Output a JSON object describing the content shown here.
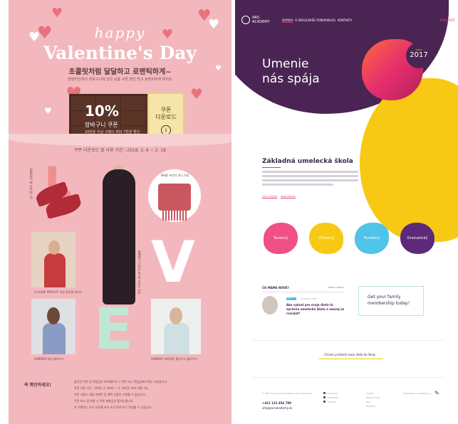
{
  "left": {
    "happy": "happy",
    "title": "Valentine's Day",
    "korean_headline": "초콜릿처럼 달달하고 로맨틱하게~",
    "korean_sub": "발렌타인데이 장바구니에 담은 상품 쿠폰 할인 받고 로맨틱하게 데이트",
    "coupon_pct": "10%",
    "coupon_label": "장바구니 쿠폰",
    "coupon_note": "20만원 이상 구매시 최대 7만원 할인",
    "coupon_download": "쿠폰\n다운로드",
    "coupon_download_icon": "down-arrow",
    "period": "쿠폰 다운로드 및 사용 기간 : 2018. 2. 6 ~ 2. 18",
    "letters": [
      "L",
      "V",
      "E"
    ],
    "captions": [
      "CLAUDE PIERLOT 프릴 플로럴 원피스",
      "SANDRO 벨 소매 울 니트",
      "BIMBA Y LOLA 파이버 브라스 가방",
      "MAJE 프린지 미니 가방",
      "SANDRO 테리 블라우스",
      "SANDRO 퍼플레트 블라우스 블라우스"
    ],
    "notice_title": "꼭 확인하세요!",
    "notice_lines": [
      "할인된 쿠폰 및 적립금은 마이페이지 > 쿠폰 또는 적립금에서 확인 가능합니다.",
      "쿠폰 사용 기간 : 2018. 2. 6(화) ~ 2. 18(일) 까지 사용 가능",
      "쿠폰 사용시 세일 이벤트 등 혜택 상품은 사용할 수 없습니다.",
      "주문 취소 및 반품 시 쿠폰 재발급이 불가능합니다.",
      "본 이벤트는 당사 사정에 따라 조기 종료 또는 변경될 수 있습니다."
    ]
  },
  "right": {
    "logo": "ARS ACADEMY",
    "nav": [
      "DOMOV",
      "O ŠKOLE",
      "NAŠE PONUKY",
      "BLOG",
      "KONTAKTY"
    ],
    "login": "PRIHLÁSIŤ",
    "hero_line1": "Umenie",
    "hero_line2": "nás spája",
    "since_label": "SINCE",
    "since_year": "2017",
    "section_title": "Základná umelecká škola",
    "links": [
      "VIAC O ŠKOLE",
      "NAŠE PONUKY"
    ],
    "departments": [
      "Tanečný",
      "Výtvarný",
      "Hudobný",
      "Dramatický"
    ],
    "news_heading": "ČO MÁME NOVÉ?",
    "news_all": "VŠETKY SPRÁVY",
    "news_tag": "UMENIE",
    "news_date": "24 marec 2017",
    "news_title": "Ako vybrať pre svoje dieťa tú správnu umeleckú školu a naozaj sa rozvíjať?",
    "family_text": "Get your family membership today!",
    "cta": "Chcem prihlásiť svoje dieťa do školy",
    "footer_copy": "© 2017 Ars Academy. Všetky práva vyhradené.",
    "footer_social": [
      "Facebook",
      "Instagram",
      "YouTube"
    ],
    "footer_links": [
      "O škole",
      "Naše ponuky",
      "Blog",
      "Kontakty"
    ],
    "footer_credit": "Webdesign a realizácia by",
    "phone": "+421 123 456 789",
    "email": "ahoj@arsakademy.sk"
  },
  "colors": {
    "pink_bg": "#f3b8bd",
    "purple": "#4a2553",
    "yellow": "#f7c914",
    "magenta": "#e03c6a",
    "dept_colors": [
      "#f04f88",
      "#f7c914",
      "#4fc3e8",
      "#5c2a78"
    ]
  }
}
